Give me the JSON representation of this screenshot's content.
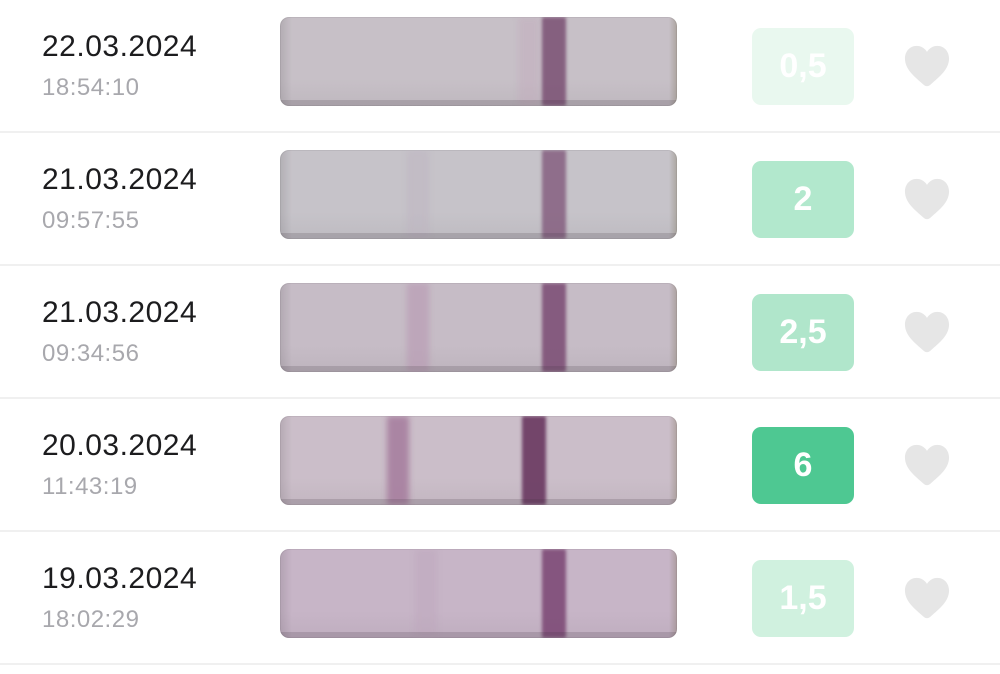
{
  "results": [
    {
      "date": "22.03.2024",
      "time": "18:54:10",
      "value": "0,5",
      "badge_color": "#e9f8ef",
      "strip_color": "#c7c0c7",
      "control_line_color": "#7a4f73",
      "control_line_intensity": 0.85,
      "test_line_color": "#c2a9bc",
      "test_line_intensity": 0.05
    },
    {
      "date": "21.03.2024",
      "time": "09:57:55",
      "value": "2",
      "badge_color": "#b2e8cd",
      "strip_color": "#c6c3c9",
      "control_line_color": "#7c5276",
      "control_line_intensity": 0.75,
      "test_line_color": "#bdb3c0",
      "test_line_intensity": 0.1
    },
    {
      "date": "21.03.2024",
      "time": "09:34:56",
      "value": "2,5",
      "badge_color": "#b0e6cb",
      "strip_color": "#c6bcc6",
      "control_line_color": "#7a4a72",
      "control_line_intensity": 0.85,
      "test_line_color": "#b898b2",
      "test_line_intensity": 0.25
    },
    {
      "date": "20.03.2024",
      "time": "11:43:19",
      "value": "6",
      "badge_color": "#4ec892",
      "strip_color": "#cbbec9",
      "control_line_color": "#6e3f66",
      "control_line_intensity": 0.95,
      "test_line_color": "#a77f9f",
      "test_line_intensity": 0.55
    },
    {
      "date": "19.03.2024",
      "time": "18:02:29",
      "value": "1,5",
      "badge_color": "#d0f1df",
      "strip_color": "#c7b5c7",
      "control_line_color": "#7a4572",
      "control_line_intensity": 0.85,
      "test_line_color": "#bda6bc",
      "test_line_intensity": 0.1
    }
  ],
  "heart_color": "#e6e6e6",
  "heart_icon": "heart-icon",
  "divider_color": "#f0f0f0"
}
